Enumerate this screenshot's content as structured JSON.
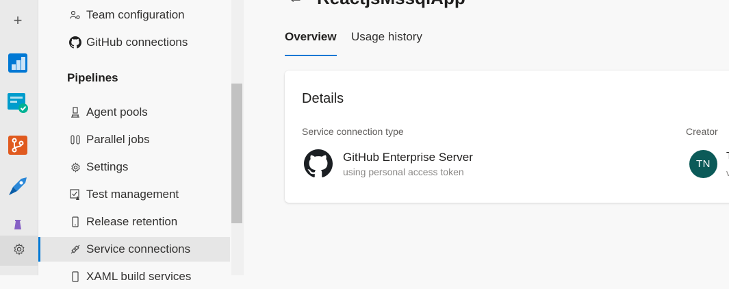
{
  "rail": {
    "items": [
      {
        "name": "add",
        "icon": "plus-icon"
      },
      {
        "name": "boards",
        "icon": "boards-icon",
        "color": "#0078d4"
      },
      {
        "name": "test-plans-board",
        "icon": "board-check-icon",
        "color": "#009ccc"
      },
      {
        "name": "repos",
        "icon": "repos-icon",
        "color": "#e05a1f"
      },
      {
        "name": "pipelines",
        "icon": "pipelines-icon",
        "color": "#2b88d8"
      },
      {
        "name": "artifacts",
        "icon": "flask-icon",
        "color": "#8661c5"
      },
      {
        "name": "project-settings",
        "icon": "gear-icon"
      }
    ]
  },
  "subnav": {
    "items_top": [
      {
        "label": "Team configuration",
        "icon": "team-config-icon"
      },
      {
        "label": "GitHub connections",
        "icon": "github-icon"
      }
    ],
    "group": "Pipelines",
    "items": [
      {
        "label": "Agent pools",
        "icon": "agent-pool-icon"
      },
      {
        "label": "Parallel jobs",
        "icon": "parallel-jobs-icon"
      },
      {
        "label": "Settings",
        "icon": "gear-icon"
      },
      {
        "label": "Test management",
        "icon": "test-management-icon"
      },
      {
        "label": "Release retention",
        "icon": "phone-icon"
      },
      {
        "label": "Service connections",
        "icon": "plug-icon",
        "selected": true
      },
      {
        "label": "XAML build services",
        "icon": "build-icon"
      }
    ]
  },
  "main": {
    "title": "ReactjsMssqlApp",
    "tabs": [
      {
        "label": "Overview",
        "active": true
      },
      {
        "label": "Usage history",
        "active": false
      }
    ],
    "details": {
      "title": "Details",
      "type_label": "Service connection type",
      "creator_label": "Creator",
      "connection_name": "GitHub Enterprise Server",
      "connection_sub": "using personal access token",
      "creator_initials": "TN",
      "creator_name_cut": "T",
      "creator_sub_cut": "v"
    }
  },
  "colors": {
    "accent": "#0078d4",
    "avatar": "#0b5a58"
  }
}
